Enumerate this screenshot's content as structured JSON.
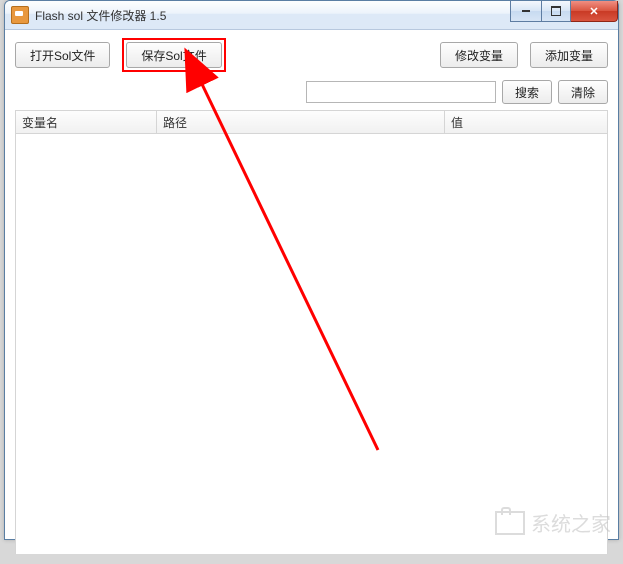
{
  "window": {
    "title": "Flash sol 文件修改器 1.5"
  },
  "toolbar": {
    "open_label": "打开Sol文件",
    "save_label": "保存Sol文件",
    "modify_var_label": "修改变量",
    "add_var_label": "添加变量"
  },
  "search": {
    "value": "",
    "search_label": "搜索",
    "clear_label": "清除"
  },
  "table": {
    "columns": {
      "name": "变量名",
      "path": "路径",
      "value": "值"
    },
    "rows": []
  },
  "watermark": {
    "text": "系统之家"
  }
}
